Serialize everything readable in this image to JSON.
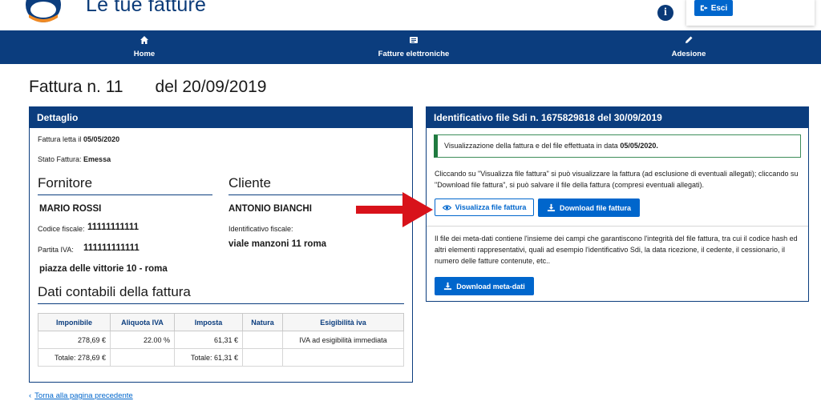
{
  "header": {
    "app_title": "Le tue fatture",
    "logout_label": "Esci"
  },
  "nav": {
    "items": [
      {
        "label": "Home",
        "icon": "home-icon"
      },
      {
        "label": "Fatture elettroniche",
        "icon": "list-icon"
      },
      {
        "label": "Adesione",
        "icon": "pencil-icon"
      }
    ]
  },
  "invoice": {
    "title": "Fattura n. 11",
    "date": "del 20/09/2019"
  },
  "detail": {
    "heading": "Dettaglio",
    "read_label": "Fattura letta il",
    "read_value": "05/05/2020",
    "status_label": "Stato Fattura:",
    "status_value": "Emessa",
    "supplier": {
      "heading": "Fornitore",
      "name": "MARIO ROSSI",
      "tax_code_label": "Codice fiscale:",
      "tax_code": "11111111111",
      "vat_label": "Partita IVA:",
      "vat": "111111111111",
      "address": "piazza delle vittorie 10 - roma"
    },
    "client": {
      "heading": "Cliente",
      "name": "ANTONIO BIANCHI",
      "id_label": "Identificativo fiscale:",
      "address": "viale manzoni 11 roma"
    },
    "accounting_heading": "Dati contabili della fattura",
    "table": {
      "headers": [
        "Imponibile",
        "Aliquota IVA",
        "Imposta",
        "Natura",
        "Esigibilità iva"
      ],
      "row": [
        "278,69 €",
        "22.00 %",
        "61,31 €",
        "",
        "IVA ad esigibilità immediata"
      ],
      "totals": [
        "Totale: 278,69 €",
        "",
        "Totale: 61,31 €",
        "",
        ""
      ]
    }
  },
  "sdi": {
    "heading": "Identificativo file Sdi n. 1675829818 del 30/09/2019",
    "notice_text": "Visualizzazione della fattura e del file effettuata in data",
    "notice_date": "05/05/2020.",
    "para1": "Cliccando su \"Visualizza file fattura\" si può visualizzare la fattura (ad esclusione di eventuali allegati); cliccando su \"Download file fattura\", si può salvare il file della fattura (compresi eventuali allegati).",
    "view_button": "Visualizza file fattura",
    "download_button": "Download file fattura",
    "para2": "Il file dei meta-dati contiene l'insieme dei campi che garantiscono l'integrità del file fattura, tra cui il codice hash ed altri elementi rappresentativi, quali ad esempio l'identificativo Sdi, la data ricezione, il cedente, il cessionario, il numero delle fatture contenute, etc..",
    "metadata_button": "Download meta-dati"
  },
  "back_link": "Torna alla pagina precedente",
  "colors": {
    "primary": "#0b3d7e",
    "button": "#0066cc",
    "success": "#1f7a3f",
    "arrow": "#d8121a"
  }
}
